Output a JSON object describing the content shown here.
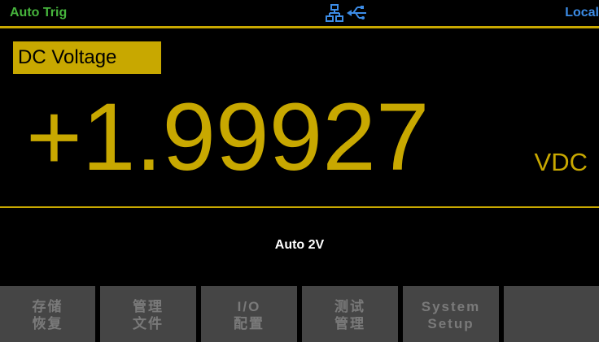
{
  "status_bar": {
    "trigger_mode": "Auto Trig",
    "lan_icon": "lan-network-icon",
    "usb_icon": "usb-icon",
    "remote_state": "Local"
  },
  "measurement": {
    "function": "DC Voltage",
    "reading": "+1.99927",
    "unit": "VDC",
    "range": "Auto 2V"
  },
  "softkeys": [
    {
      "line1": "存储",
      "line2": "恢复"
    },
    {
      "line1": "管理",
      "line2": "文件"
    },
    {
      "line1": "I/O",
      "line2": "配置"
    },
    {
      "line1": "测试",
      "line2": "管理"
    },
    {
      "line1": "System",
      "line2": "Setup"
    },
    {
      "line1": "",
      "line2": ""
    }
  ],
  "colors": {
    "accent_yellow": "#c8a800",
    "status_green": "#46b43c",
    "status_blue": "#3c8ce6",
    "softkey_bg": "#454545",
    "softkey_text": "#7a7a7a",
    "background": "#000000"
  }
}
